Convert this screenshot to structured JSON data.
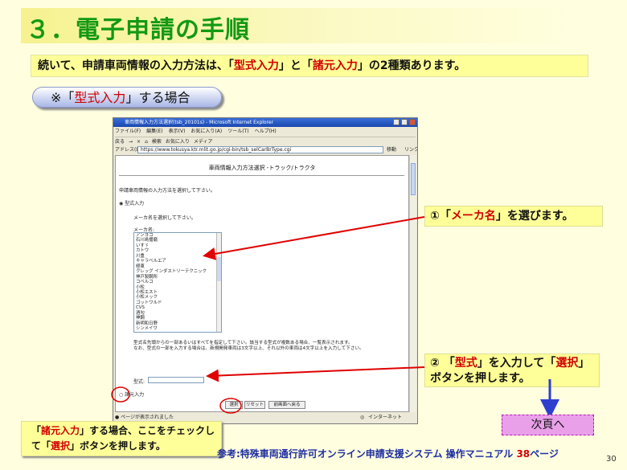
{
  "slide": {
    "title": "３．電子申請の手順",
    "intro_pre": "続いて、申請車両情報の入力方法は、「",
    "intro_kw1": "型式入力",
    "intro_mid": "」と「",
    "intro_kw2": "諸元入力",
    "intro_post": "」の2種類あります。",
    "case_pre": "※「",
    "case_kw": "型式入力",
    "case_post": "」する場合",
    "callout1_pre": "①「",
    "callout1_kw": "メーカ名",
    "callout1_post": "」を選びます。",
    "callout2_pre": "② 「",
    "callout2_kw1": "型式",
    "callout2_mid": "」を入力して「",
    "callout2_kw2": "選択",
    "callout2_post": "」ボタンを押します。",
    "callout3_pre": "「",
    "callout3_kw1": "諸元入力",
    "callout3_mid": "」する場合、ここをチェックして「",
    "callout3_kw2": "選択",
    "callout3_post": "」ボタンを押します。",
    "next_button": "次頁へ",
    "reference_pre": "参考:特殊車両通行許可オンライン申請支援システム 操作マニュアル ",
    "reference_page": "38",
    "reference_post": "ページ",
    "page_number": "30"
  },
  "browser": {
    "window_title": "車両情報入力方法選択(tsb_20101s) - Microsoft Internet Explorer",
    "menu": [
      "ファイル(F)",
      "編集(E)",
      "表示(V)",
      "お気に入り(A)",
      "ツール(T)",
      "ヘルプ(H)"
    ],
    "toolbar": [
      "戻る",
      "→",
      "×",
      "⌂",
      "検索",
      "お気に入り",
      "メディア"
    ],
    "address_label": "アドレス(D)",
    "address": "https://www.tokusya.ktr.mlit.go.jp/cgi-bin/tsb_selCarBrType.cgi",
    "go_label": "移動",
    "links_label": "リンク",
    "status_done": "ページが表示されました",
    "status_zone": "インターネット"
  },
  "form": {
    "page_title": "車両情報入力方法選択 -トラック/トラクタ",
    "instruction": "申請車両情報の入力方法を選択して下さい。",
    "radio_type": "型式入力",
    "maker_prompt": "メーカ名を選択して下さい。",
    "maker_label": "メーカ名:",
    "makers": [
      "アンヨコ",
      "石川島播磨",
      "いすゞ",
      "カトウ",
      "川重",
      "キャラベルエア",
      "極東",
      "クレッグ インダストリーテクニック",
      "神戸製鋼所",
      "コベルコ",
      "小松",
      "小松エスト",
      "小松メック",
      "ゴットワルド",
      "CVS",
      "酒勾",
      "神鋼",
      "新明和日野",
      "シンメイワ",
      "SMC"
    ],
    "note1": "型式名先頭からの一部あるいはすべてを指定して下さい。該当する型式が複数ある場合、一覧表示されます。",
    "note2": "なお、型式の一部を入力する場合は、新規開発車両は3文字以上、それ以外の車両は4文字以上を入力して下さい。",
    "model_label": "型式:",
    "radio_spec": "諸元入力",
    "btn_select": "選択",
    "btn_reset": "リセット",
    "btn_back": "前画面へ戻る"
  },
  "colors": {
    "title_green": "#139913",
    "keyword_red": "#d10000",
    "callout_yellow": "#ffff99",
    "arrow_red": "#e00000",
    "arrow_blue": "#2e3fd0",
    "next_pink": "#e9a0e9"
  }
}
